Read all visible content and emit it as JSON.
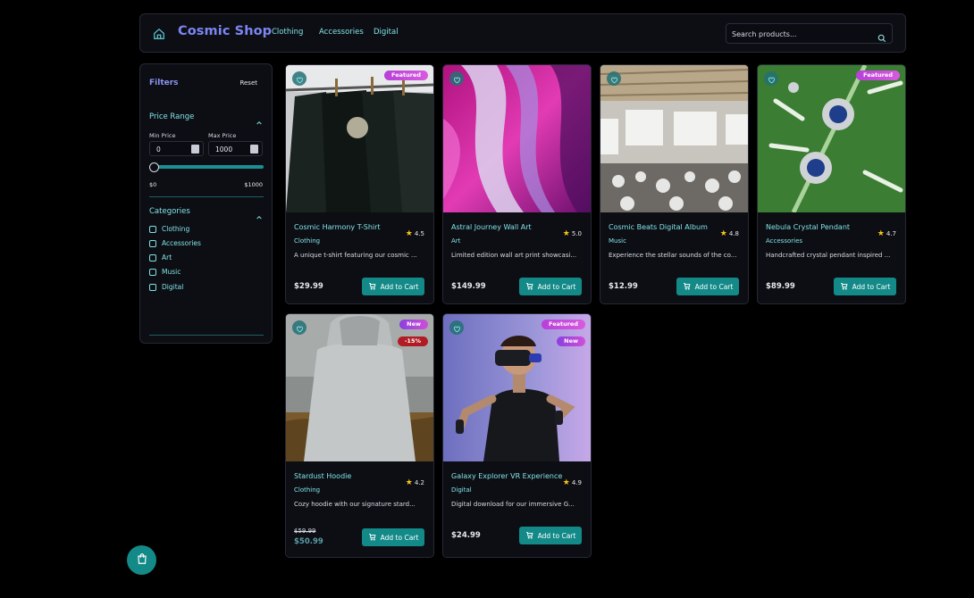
{
  "header": {
    "brand": "Cosmic Shop",
    "nav": [
      "Clothing",
      "Accessories",
      "Digital"
    ],
    "search_placeholder": "Search products..."
  },
  "filters": {
    "title": "Filters",
    "reset": "Reset",
    "price_range": {
      "title": "Price Range",
      "min_label": "Min Price",
      "max_label": "Max Price",
      "min_value": "0",
      "max_value": "1000",
      "range_min_label": "$0",
      "range_max_label": "$1000"
    },
    "categories": {
      "title": "Categories",
      "items": [
        "Clothing",
        "Accessories",
        "Art",
        "Music",
        "Digital"
      ]
    }
  },
  "products": [
    {
      "name": "Cosmic Harmony T-Shirt",
      "rating": "4.5",
      "category": "Clothing",
      "description": "A unique t-shirt featuring our cosmic ...",
      "price": "$29.99",
      "badges": [
        "Featured"
      ],
      "button": "Add to Cart"
    },
    {
      "name": "Astral Journey Wall Art",
      "rating": "5.0",
      "category": "Art",
      "description": "Limited edition wall art print showcasi...",
      "price": "$149.99",
      "badges": [],
      "button": "Add to Cart"
    },
    {
      "name": "Cosmic Beats Digital Album",
      "rating": "4.8",
      "category": "Music",
      "description": "Experience the stellar sounds of the co...",
      "price": "$12.99",
      "badges": [],
      "button": "Add to Cart"
    },
    {
      "name": "Nebula Crystal Pendant",
      "rating": "4.7",
      "category": "Accessories",
      "description": "Handcrafted crystal pendant inspired ...",
      "price": "$89.99",
      "badges": [
        "Featured"
      ],
      "button": "Add to Cart"
    },
    {
      "name": "Stardust Hoodie",
      "rating": "4.2",
      "category": "Clothing",
      "description": "Cozy hoodie with our signature stard...",
      "old_price": "$59.99",
      "price": "$50.99",
      "badges": [
        "New",
        "-15%"
      ],
      "button": "Add to Cart"
    },
    {
      "name": "Galaxy Explorer VR Experience",
      "rating": "4.9",
      "category": "Digital",
      "description": "Digital download for our immersive G...",
      "price": "$24.99",
      "badges": [
        "Featured",
        "New"
      ],
      "button": "Add to Cart"
    }
  ],
  "colors": {
    "accent": "#138a88",
    "brand": "#7c86f2",
    "link": "#7fe3e6",
    "star": "#f5c518"
  }
}
